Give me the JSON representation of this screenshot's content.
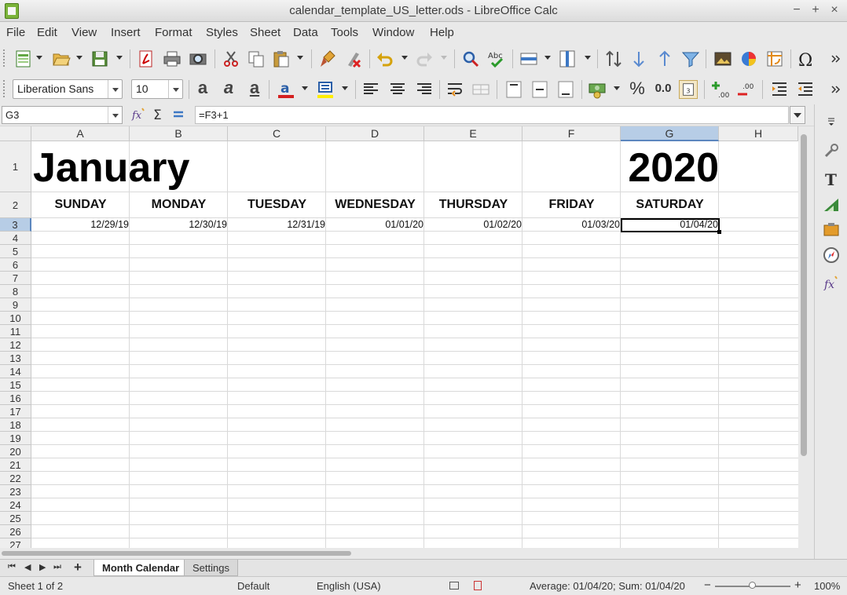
{
  "window": {
    "title": "calendar_template_US_letter.ods - LibreOffice Calc",
    "controls": [
      "−",
      "+",
      "×"
    ]
  },
  "menubar": [
    "File",
    "Edit",
    "View",
    "Insert",
    "Format",
    "Styles",
    "Sheet",
    "Data",
    "Tools",
    "Window",
    "Help"
  ],
  "toolbar1_icons": [
    "new-spreadsheet-icon",
    "open-icon",
    "save-icon",
    "export-pdf-icon",
    "print-icon",
    "print-preview-icon",
    "cut-icon",
    "copy-icon",
    "paste-icon",
    "clone-formatting-icon",
    "clear-formatting-icon",
    "undo-icon",
    "redo-icon",
    "find-replace-icon",
    "spelling-icon",
    "row-icon",
    "column-icon",
    "sort-icon",
    "sort-ascending-icon",
    "sort-descending-icon",
    "autofilter-icon",
    "image-icon",
    "chart-icon",
    "pivot-table-icon",
    "special-character-icon"
  ],
  "formatting": {
    "font_name": "Liberation Sans",
    "font_size": "10",
    "bold_glyph": "a",
    "italic_glyph": "a",
    "underline_glyph": "a",
    "font_color": "#d42020",
    "highlight_color": "#ffee00",
    "percent_glyph": "%",
    "decimal_glyph": "0.0"
  },
  "formula_bar": {
    "cell_reference": "G3",
    "formula": "=F3+1"
  },
  "columns": [
    "A",
    "B",
    "C",
    "D",
    "E",
    "F",
    "G",
    "H"
  ],
  "selected_column": "G",
  "rows": [
    "1",
    "2",
    "3",
    "4",
    "5",
    "6",
    "7",
    "8",
    "9",
    "10",
    "11",
    "12",
    "13",
    "14",
    "15",
    "16",
    "17",
    "18",
    "19",
    "20",
    "21",
    "22",
    "23",
    "24",
    "25",
    "26",
    "27"
  ],
  "selected_row": "3",
  "sheet": {
    "month": "January",
    "year": "2020",
    "weekdays": [
      "SUNDAY",
      "MONDAY",
      "TUESDAY",
      "WEDNESDAY",
      "THURSDAY",
      "FRIDAY",
      "SATURDAY"
    ],
    "dates": [
      "12/29/19",
      "12/30/19",
      "12/31/19",
      "01/01/20",
      "01/02/20",
      "01/03/20",
      "01/04/20"
    ]
  },
  "sheet_tabs": {
    "active": "Month Calendar",
    "other": "Settings"
  },
  "statusbar": {
    "sheet_info": "Sheet 1 of 2",
    "page_style": "Default",
    "language": "English (USA)",
    "summary": "Average: 01/04/20; Sum: 01/04/20",
    "zoom_minus": "−",
    "zoom_plus": "+",
    "zoom": "100%"
  }
}
